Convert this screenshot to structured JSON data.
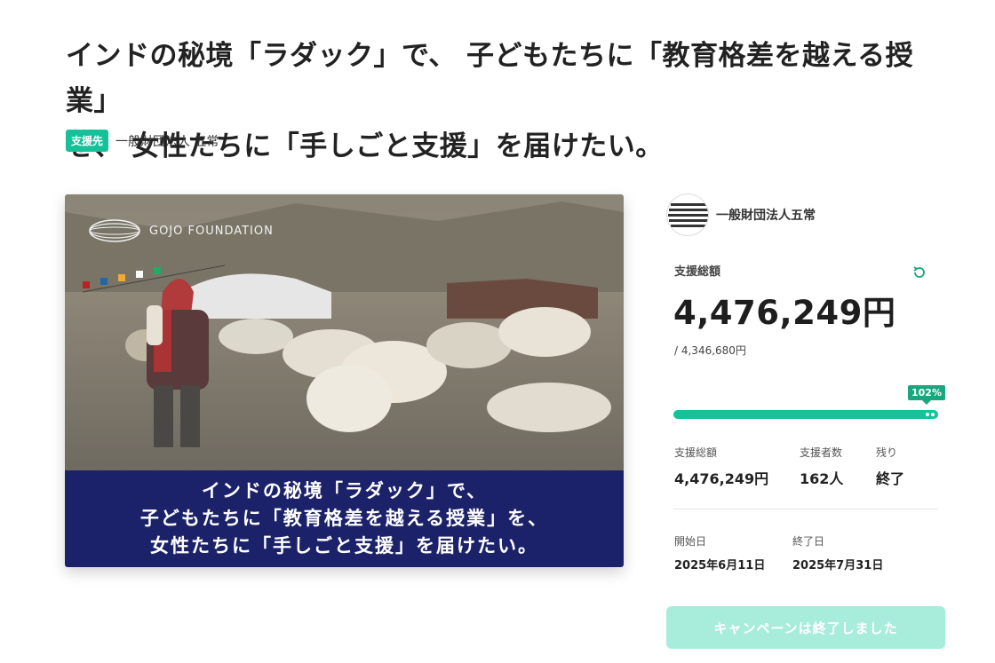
{
  "page": {
    "title_line1": "インドの秘境「ラダック」で、 子どもたちに「教育格差を越える授業」",
    "title_line2": "を、 女性たちに「手しごと支援」を届けたい。",
    "support_tag": "支援先",
    "support_org": "一般財団法人 五常"
  },
  "hero": {
    "logo_text": "GOJO FOUNDATION",
    "banner_line1": "インドの秘境「ラダック」で、",
    "banner_line2": "子どもたちに「教育格差を越える授業」を、",
    "banner_line3": "女性たちに「手しごと支援」を届けたい。",
    "banner_color": "#1c2269"
  },
  "sidebar": {
    "org_name": "一般財団法人五常",
    "total_label": "支援総額",
    "total_amount": "4,476,249円",
    "goal_amount": "/ 4,346,680円",
    "progress_label": "102%",
    "progress_fraction": 1.0,
    "stats": [
      {
        "label": "支援総額",
        "value": "4,476,249円"
      },
      {
        "label": "支援者数",
        "value": "162人"
      },
      {
        "label": "残り",
        "value": "終了"
      }
    ],
    "dates": [
      {
        "label": "開始日",
        "value": "2025年6月11日"
      },
      {
        "label": "終了日",
        "value": "2025年7月31日"
      }
    ],
    "ended_button": "キャンペーンは終了しました",
    "accent_color": "#16c299"
  }
}
